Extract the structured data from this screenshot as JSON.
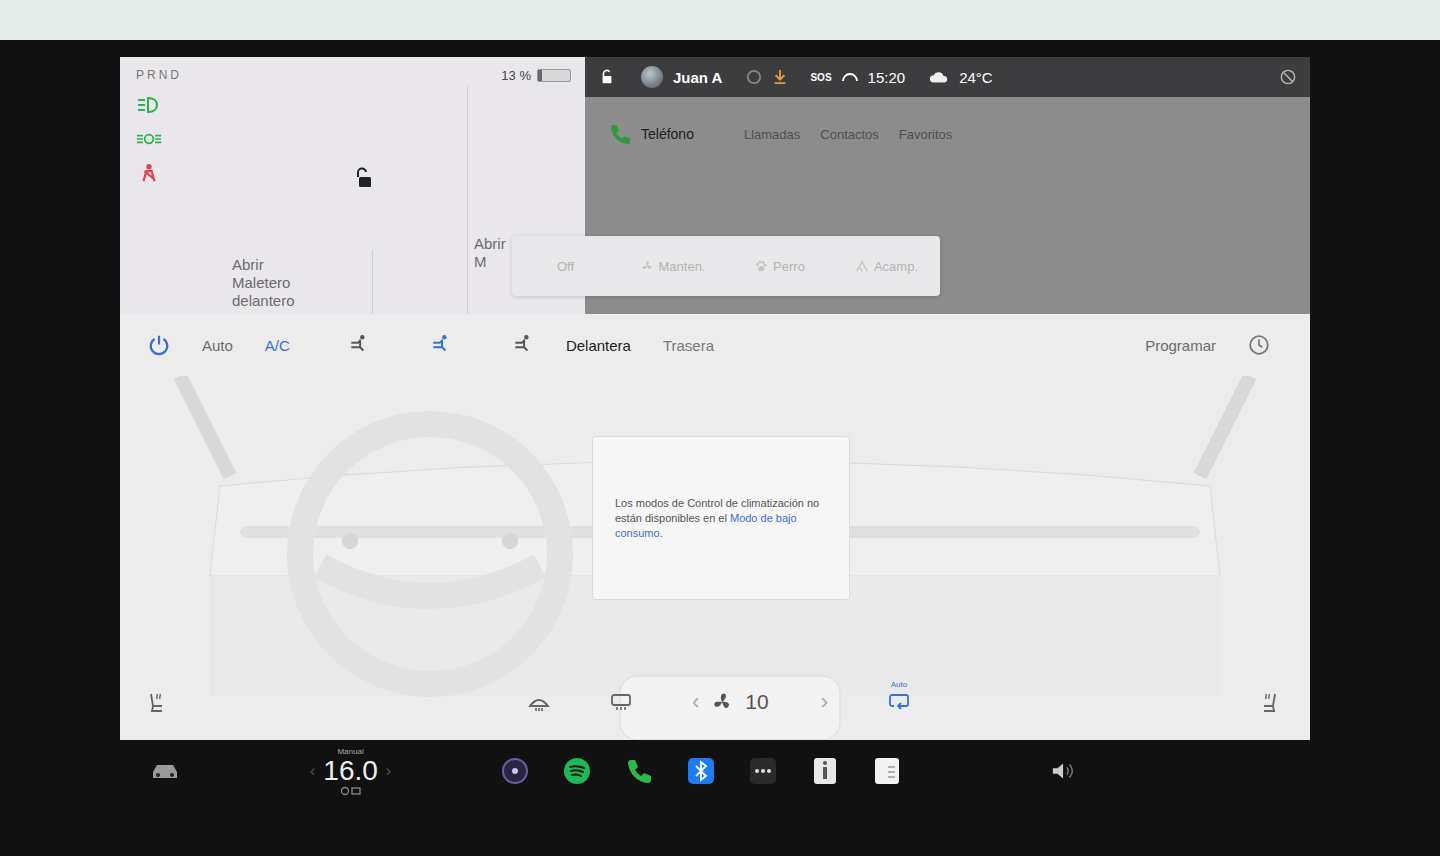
{
  "vehicle": {
    "gear": "PRND",
    "battery": {
      "reading": "13 %",
      "level": 0.13
    },
    "frunk_label": "Abrir Maletero delantero",
    "trunk_label": "Abrir M"
  },
  "status_bar": {
    "user": "Juan A",
    "sos": "SOS",
    "time": "15:20",
    "temperature": "24°C"
  },
  "phone": {
    "title": "Teléfono",
    "tabs": [
      {
        "label": "Llamadas",
        "selected": false
      },
      {
        "label": "Contactos",
        "selected": false
      },
      {
        "label": "Favoritos",
        "selected": false
      }
    ]
  },
  "climate_keep_modes": [
    {
      "label": "Off",
      "kind": "plain",
      "disabled": true
    },
    {
      "label": "Manten.",
      "kind": "fan",
      "disabled": true
    },
    {
      "label": "Perro",
      "kind": "paw",
      "disabled": true
    },
    {
      "label": "Acamp.",
      "kind": "tent",
      "disabled": true
    }
  ],
  "climate_toolbar": {
    "auto": {
      "label": "Auto",
      "on": false
    },
    "ac": {
      "label": "A/C",
      "on": true
    },
    "airflow": [
      {
        "selected": false
      },
      {
        "selected": true
      },
      {
        "selected": false
      }
    ],
    "zones": [
      {
        "label": "Delantera",
        "selected": true
      },
      {
        "label": "Trasera",
        "selected": false
      }
    ],
    "schedule": "Programar"
  },
  "notice": {
    "text": "Los modos de Control de climatización no están disponibles en el ",
    "link": "Modo de bajo consumo",
    "end": "."
  },
  "fan": {
    "prev": "‹",
    "speed": "10",
    "next": "›"
  },
  "recirculation": {
    "label": "Auto",
    "on": true
  },
  "taskbar": {
    "temperature_mode": "Manual",
    "temperature": "16.0",
    "prev": "‹",
    "next": "›"
  }
}
